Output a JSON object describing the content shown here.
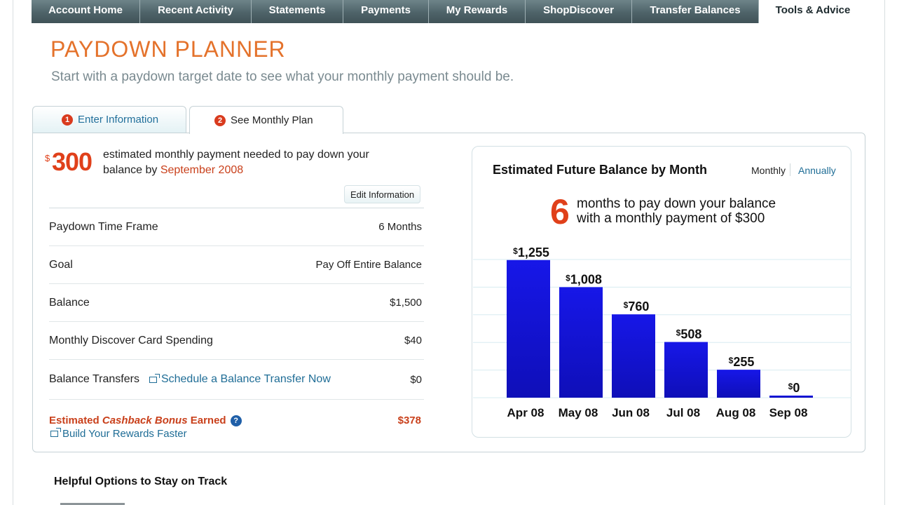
{
  "nav": {
    "tabs": [
      {
        "label": "Account Home",
        "width": 155
      },
      {
        "label": "Recent Activity",
        "width": 159
      },
      {
        "label": "Statements",
        "width": 131
      },
      {
        "label": "Payments",
        "width": 122
      },
      {
        "label": "My Rewards",
        "width": 138
      },
      {
        "label": "ShopDiscover",
        "width": 152
      },
      {
        "label": "Transfer Balances",
        "width": 181
      },
      {
        "label": "Tools & Advice",
        "width": 154
      }
    ],
    "active": "Tools & Advice"
  },
  "page": {
    "title": "PAYDOWN PLANNER",
    "subtitle": "Start with a paydown target date to see what your monthly payment should be."
  },
  "steps": [
    {
      "num": "1",
      "label": "Enter Information"
    },
    {
      "num": "2",
      "label": "See Monthly Plan"
    }
  ],
  "summary": {
    "dollar_sign": "$",
    "amount": "300",
    "text": "estimated monthly payment needed to pay down your balance by",
    "date": "September 2008",
    "edit_label": "Edit Information"
  },
  "details": [
    {
      "label": "Paydown Time Frame",
      "value": "6 Months"
    },
    {
      "label": "Goal",
      "value": "Pay Off Entire Balance"
    },
    {
      "label": "Balance",
      "value": "$1,500"
    },
    {
      "label": "Monthly Discover Card Spending",
      "value": "$40"
    },
    {
      "label": "Balance Transfers",
      "value": "$0",
      "link": "Schedule a Balance Transfer Now"
    }
  ],
  "cashback": {
    "prefix": "Estimated ",
    "italic": "Cashback Bonus",
    "suffix": " Earned",
    "value": "$378",
    "rewards_link": "Build Your Rewards Faster"
  },
  "chart_panel": {
    "title": "Estimated Future Balance by Month",
    "toggle_monthly": "Monthly",
    "toggle_annually": "Annually",
    "months_number": "6",
    "months_line1": "months to pay down your balance",
    "months_line2": "with a monthly payment of $300"
  },
  "chart_data": {
    "type": "bar",
    "categories": [
      "Apr 08",
      "May 08",
      "Jun 08",
      "Jul 08",
      "Aug 08",
      "Sep 08"
    ],
    "values": [
      1255,
      1008,
      760,
      508,
      255,
      0
    ],
    "labels": [
      "1,255",
      "1,008",
      "760",
      "508",
      "255",
      "0"
    ],
    "currency": "$",
    "title": "Estimated Future Balance by Month",
    "ylim": [
      0,
      1260
    ],
    "grid": true,
    "bar_color": "#1717e8"
  },
  "footer": {
    "heading": "Helpful Options to Stay on Track"
  },
  "colors": {
    "accent_orange": "#e4722b",
    "alert_red": "#e0401a",
    "link_blue": "#1f6d96",
    "nav_gray": "#4e6369"
  }
}
